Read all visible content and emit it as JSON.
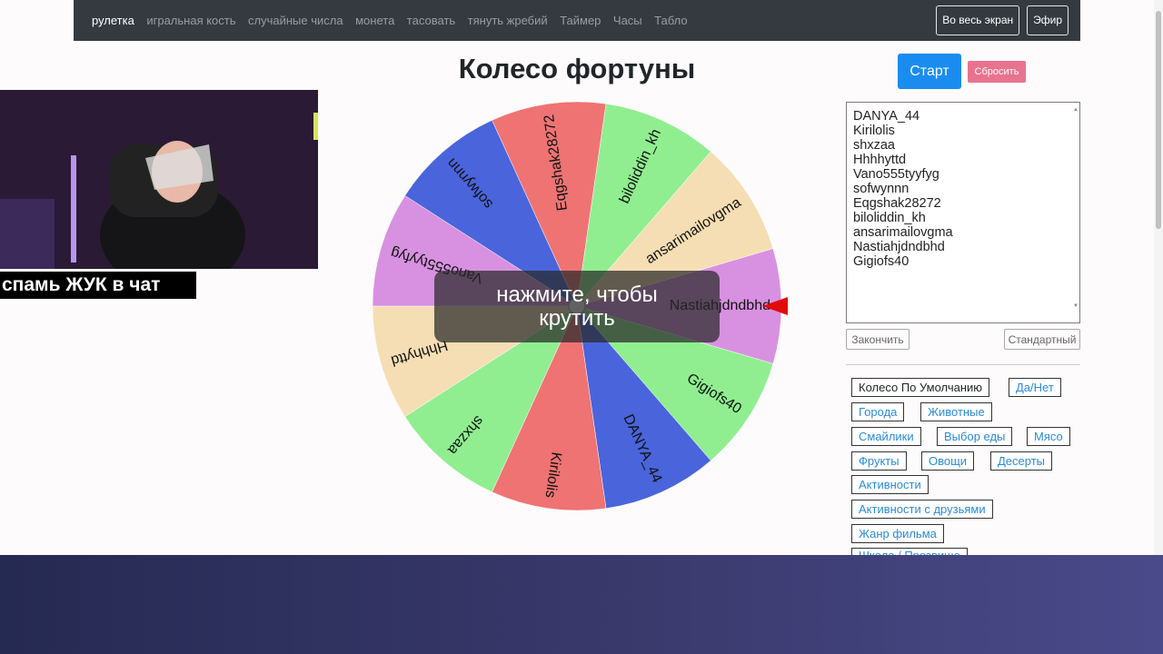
{
  "nav": {
    "items": [
      "рулетка",
      "игральная кость",
      "случайные числа",
      "монета",
      "тасовать",
      "тянуть жребий",
      "Таймер",
      "Часы",
      "Табло"
    ],
    "fullscreen_label": "Во весь экран",
    "broadcast_label": "Эфир"
  },
  "title": "Колесо фортуны",
  "controls": {
    "start_label": "Старт",
    "reset_label": "Сбросить",
    "finish_label": "Закончить",
    "standard_label": "Стандартный"
  },
  "names": [
    "DANYA_44",
    "Kirilolis",
    "shxzaa",
    "Hhhhyttd",
    "Vano555tyyfyg",
    "sofwynnn",
    "Eqgshak28272",
    "biloliddin_kh",
    "ansarimailovgma",
    "Nastiahjdndbhd",
    "Gigiofs40"
  ],
  "wheel": {
    "overlay_text": "нажмите, чтобы крутить",
    "segments": [
      {
        "label": "Nastiahjdndbhd",
        "color": "#d891e0"
      },
      {
        "label": "Gigiofs40",
        "color": "#90ee90"
      },
      {
        "label": "DANYA_44",
        "color": "#4a64db"
      },
      {
        "label": "Kirilolis",
        "color": "#ef7373"
      },
      {
        "label": "shxzaa",
        "color": "#90ee90"
      },
      {
        "label": "Hhhhyttd",
        "color": "#f5deb3"
      },
      {
        "label": "Vano555tyyfyg",
        "color": "#d891e0"
      },
      {
        "label": "sofwynnn",
        "color": "#4a64db"
      },
      {
        "label": "Eqgshak28272",
        "color": "#ef7373"
      },
      {
        "label": "biloliddin_kh",
        "color": "#90ee90"
      },
      {
        "label": "ansarimailovgma",
        "color": "#f5deb3"
      }
    ]
  },
  "presets": [
    "Колесо По Умолчанию",
    "Да/Нет",
    "Города",
    "Животные",
    "Смайлики",
    "Выбор еды",
    "Мясо",
    "Фрукты",
    "Овощи",
    "Десерты",
    "Активности",
    "Активности с друзьями",
    "Жанр фильма",
    "Школа / Прозвище"
  ],
  "stream": {
    "caption": "спамь ЖУК в чат"
  }
}
